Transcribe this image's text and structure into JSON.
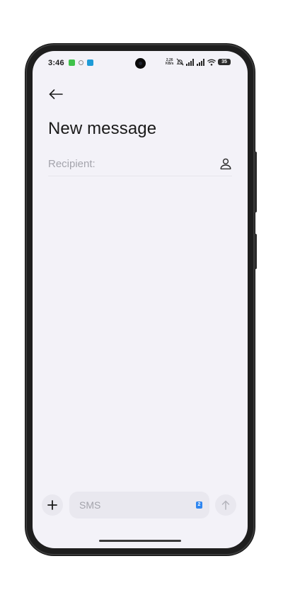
{
  "status_bar": {
    "time": "3:46",
    "net_speed_value": "2.26",
    "net_speed_unit": "KB/s",
    "battery_level": "35",
    "icons": [
      "chat-app-icon",
      "dot-icon",
      "telegram-icon",
      "mute-icon",
      "signal-icon",
      "signal-icon",
      "wifi-icon",
      "battery-icon"
    ]
  },
  "header": {
    "back_icon": "arrow-left-icon",
    "title": "New message"
  },
  "recipient": {
    "placeholder": "Recipient:",
    "value": "",
    "contact_icon": "person-icon"
  },
  "composer": {
    "add_icon": "plus-icon",
    "placeholder": "SMS",
    "value": "",
    "sim_badge": "2",
    "send_icon": "arrow-up-icon"
  },
  "colors": {
    "screen_background": "#f3f2f8",
    "field_background": "#e9e8ef",
    "text_primary": "#1a1a1a",
    "text_placeholder": "#a4a4ac",
    "sim_badge": "#2f86f0"
  }
}
